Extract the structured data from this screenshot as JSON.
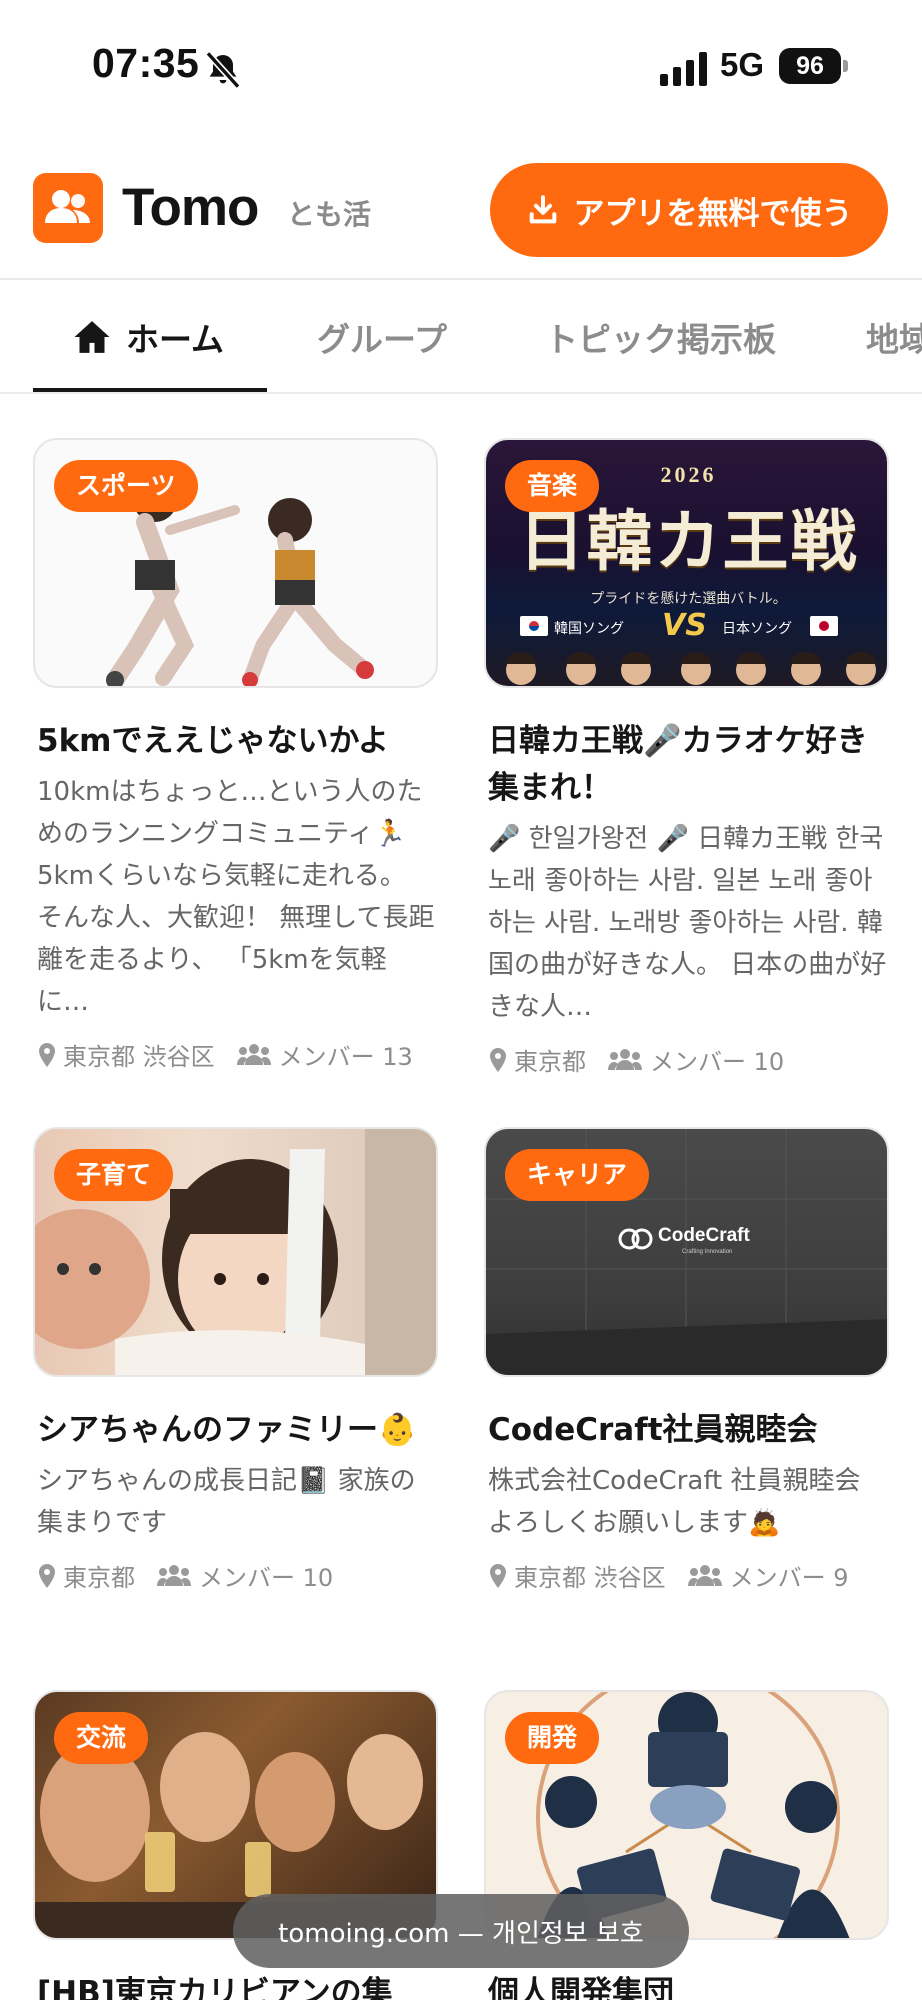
{
  "status_bar": {
    "time": "07:35",
    "network": "5G",
    "battery": "96",
    "icons": [
      "bell-muted-icon",
      "signal-icon"
    ]
  },
  "header": {
    "logo_text": "Tomo",
    "logo_sub": "とも活",
    "cta_label": "アプリを無料で使う",
    "accent_color": "#ff6a10"
  },
  "tabs": [
    {
      "label": "ホーム",
      "active": true
    },
    {
      "label": "グループ",
      "active": false
    },
    {
      "label": "トピック掲示板",
      "active": false
    },
    {
      "label": "地域",
      "active": false
    }
  ],
  "cards": [
    {
      "badge": "スポーツ",
      "title": "5kmでええじゃないかよ",
      "description": "10kmはちょっと…という人のためのランニングコミュニティ🏃 5kmくらいなら気軽に走れる。 そんな人、大歓迎！ 無理して長距離を走るより、 「5kmを気軽に…",
      "location": "東京都 渋谷区",
      "members": "メンバー 13"
    },
    {
      "badge": "音楽",
      "title": "日韓カ王戦🎤カラオケ好き集まれ！",
      "description": "🎤 한일가왕전 🎤 日韓カ王戦 한국 노래 좋아하는 사람. 일본 노래 좋아하는 사람. 노래방 좋아하는 사람. 韓国の曲が好きな人。 日本の曲が好きな人…",
      "location": "東京都",
      "members": "メンバー 10",
      "thumb_text": {
        "year": "2026",
        "headline": "日韓カ王戦",
        "tagline": "プライドを懸けた選曲バトル。",
        "left": "韓国ソング",
        "vs": "VS",
        "right": "日本ソング"
      }
    },
    {
      "badge": "子育て",
      "title": "シアちゃんのファミリー👶",
      "description": "シアちゃんの成長日記📓 家族の集まりです",
      "location": "東京都",
      "members": "メンバー 10"
    },
    {
      "badge": "キャリア",
      "title": "CodeCraft社員親睦会",
      "description": "株式会社CodeCraft 社員親睦会 よろしくお願いします🙇",
      "location": "東京都 渋谷区",
      "members": "メンバー 9",
      "thumb_text": {
        "brand": "CodeCraft",
        "brand_sub": "Crafting Innovation"
      }
    },
    {
      "badge": "交流",
      "title": "[HB]東京カリビアンの集",
      "description": "",
      "location": "",
      "members": ""
    },
    {
      "badge": "開発",
      "title": "個人開発集団",
      "description": "",
      "location": "",
      "members": ""
    }
  ],
  "toast": {
    "text": "tomoing.com — 개인정보 보호"
  }
}
